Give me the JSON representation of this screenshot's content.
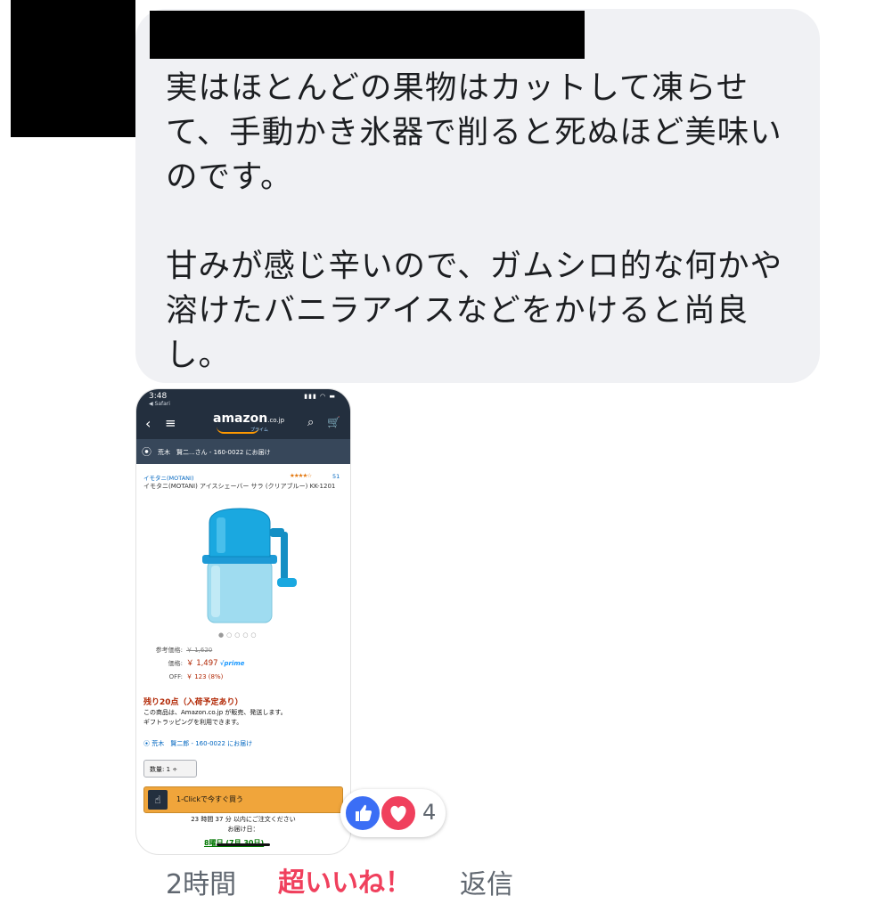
{
  "comment": {
    "text": "実はほとんどの果物はカットして凍らせて、手動かき氷器で削ると死ぬほど美味いのです。\n\n甘みが感じ辛いので、ガムシロ的な何かや溶けたバニラアイスなどをかけると尚良し。"
  },
  "screenshot": {
    "time": "3:48",
    "back_app": "◀ Safari",
    "logo": "amazon",
    "logo_suffix": ".co.jp",
    "logo_sub": "プライム",
    "address_bar": "荒木　賢二...さん - 160-0022 にお届け",
    "brand": "イモタニ(MOTANI)",
    "rating_stars": "★★★★☆",
    "review_count": "51",
    "product_title": "イモタニ(MOTANI) アイスシェーバー サラ (クリアブルー) KK-1201",
    "list_price_label": "参考価格:",
    "list_price": "￥ 1,620",
    "price_label": "価格:",
    "price": "￥ 1,497",
    "prime_label": "√prime",
    "off_label": "OFF:",
    "off_value": "￥ 123 (8%)",
    "stock": "残り20点（入荷予定あり）",
    "seller_note": "この商品は、Amazon.co.jp が販売、発送します。\nギフトラッピングを利用できます。",
    "delivery_address": "荒木　賢二郎 - 160-0022 にお届け",
    "quantity": "数量: 1 ÷",
    "buy_button": "1-Clickで今すぐ買う",
    "order_time": "23 時間 37 分 以内にご注文ください\nお届け日：",
    "delivery_date": "8曜日 (7月 30日)"
  },
  "reactions": {
    "count": "4"
  },
  "actions": {
    "time": "2時間",
    "super_like": "超いいね！",
    "reply": "返信"
  }
}
